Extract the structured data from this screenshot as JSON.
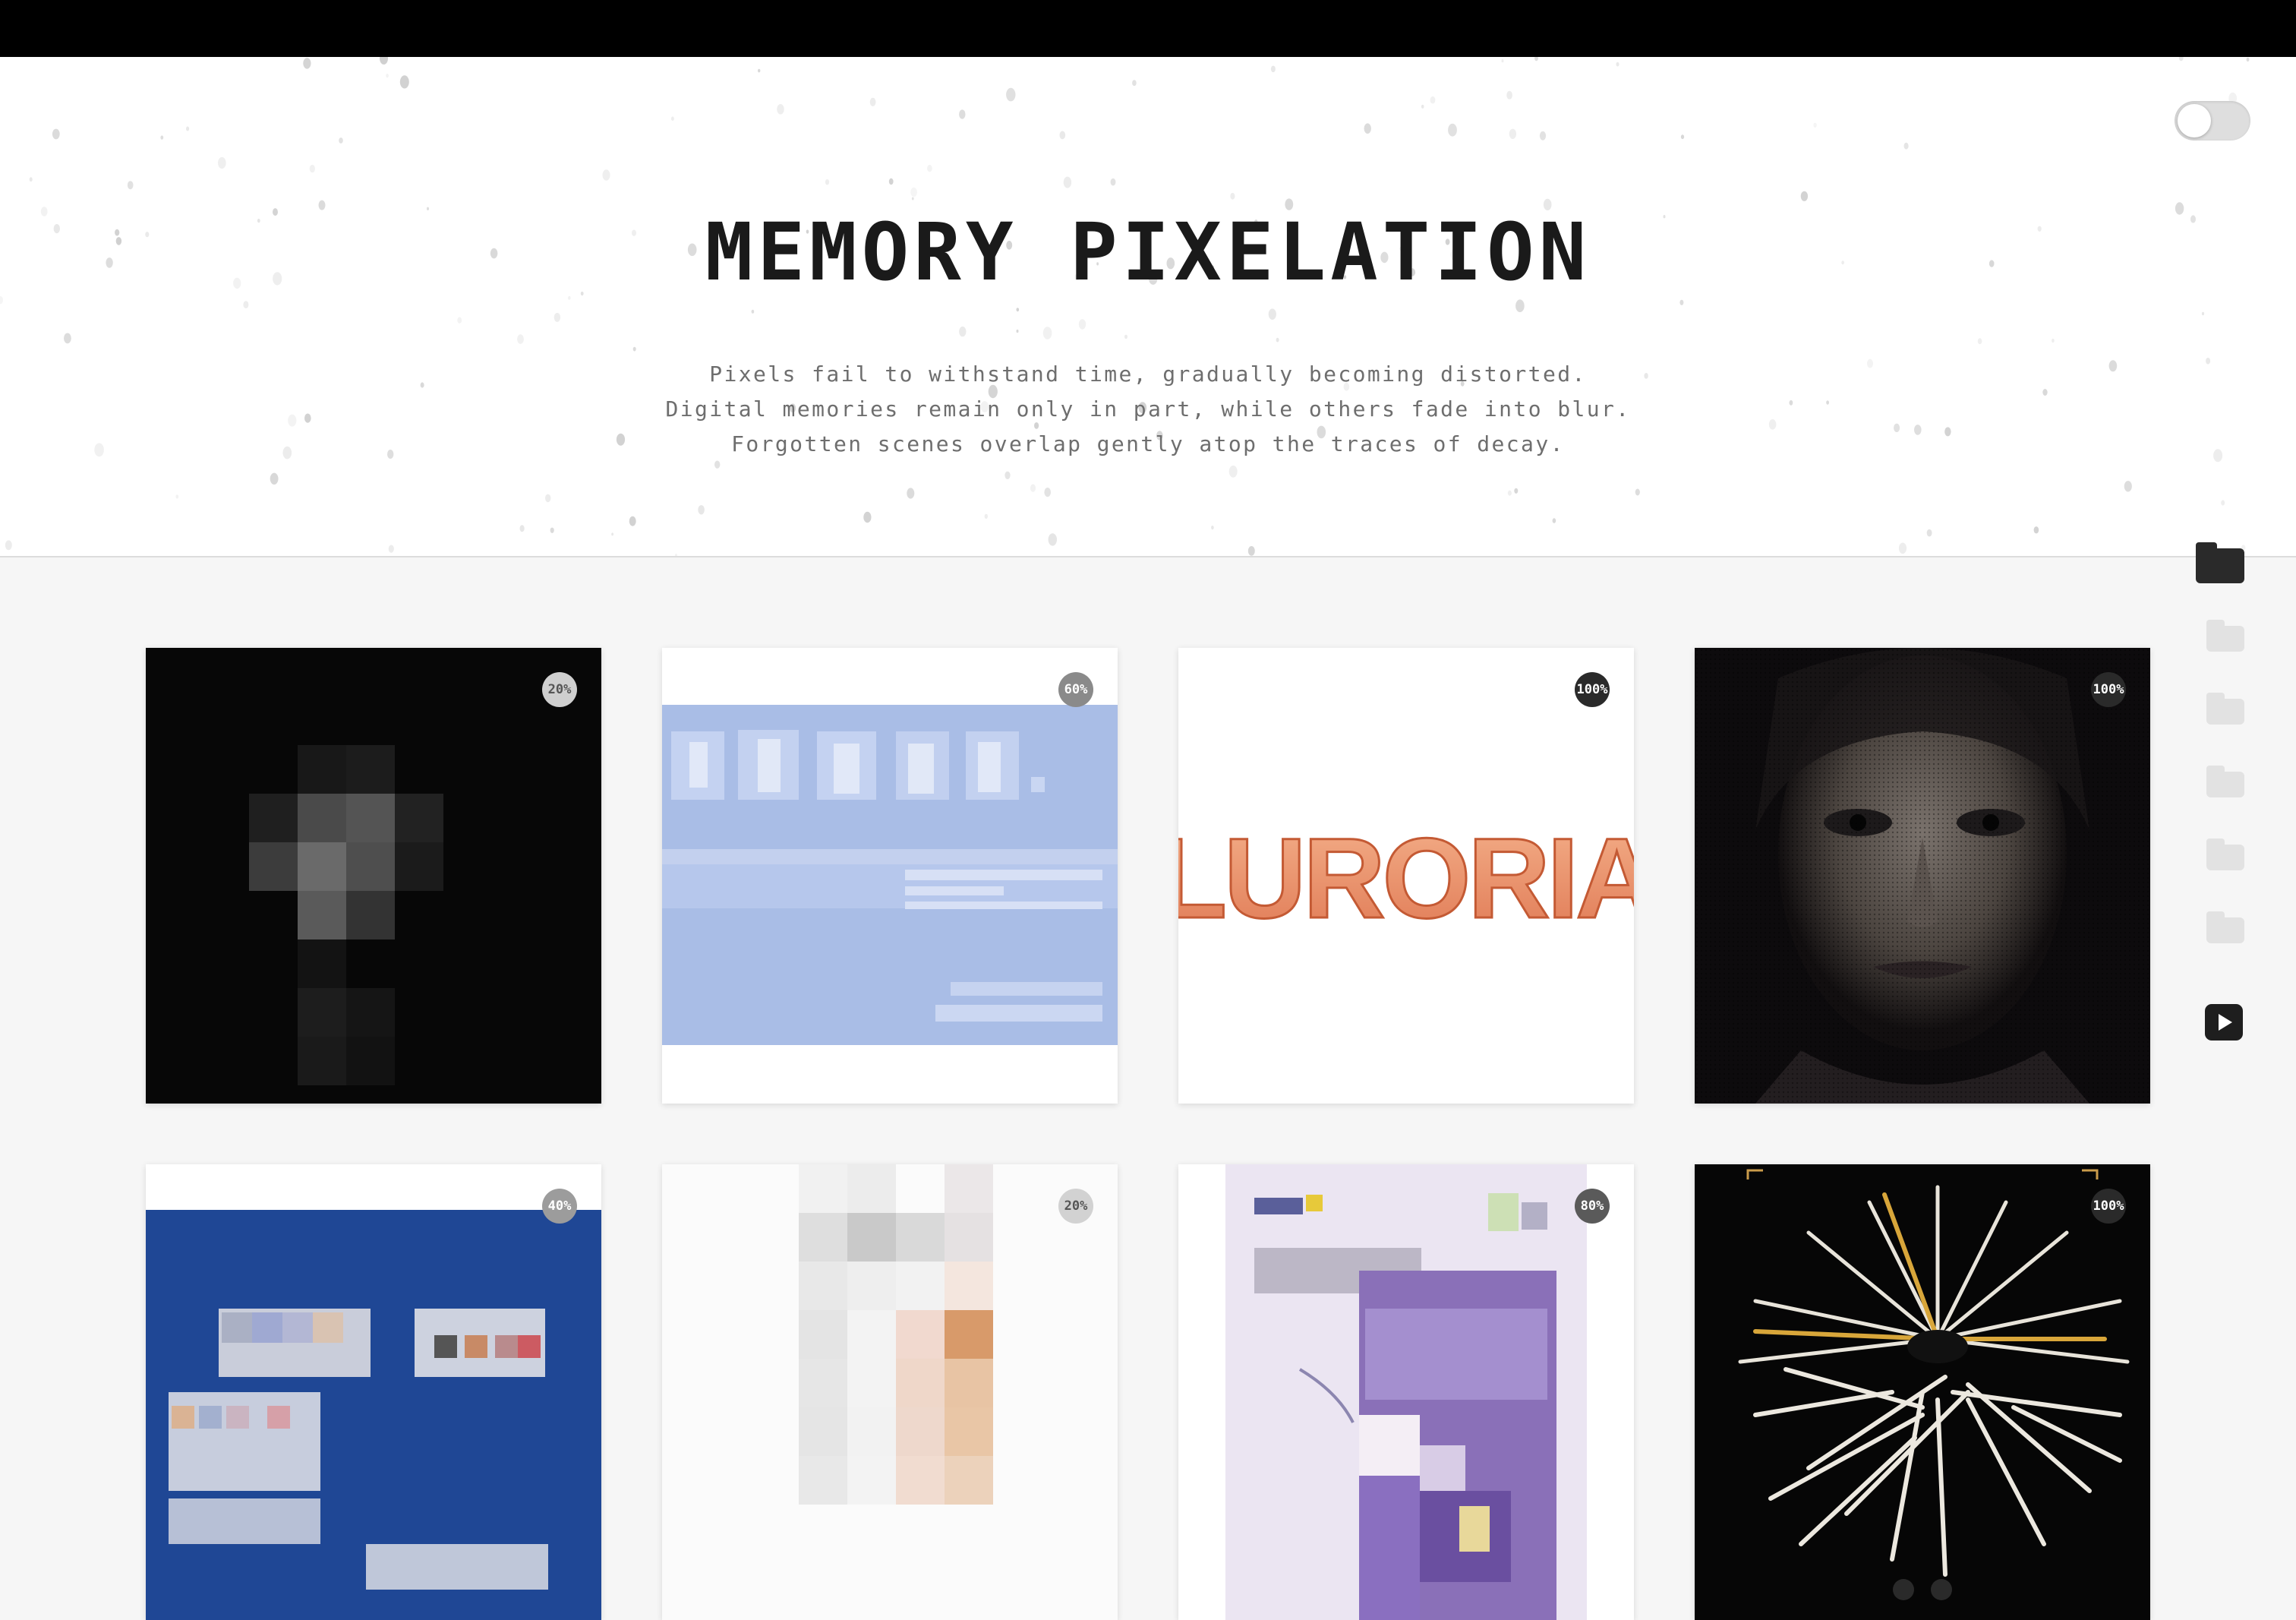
{
  "header": {
    "title": "MEMORY PIXELATION",
    "subtitle_lines": [
      "Pixels fail to withstand time, gradually becoming distorted.",
      "Digital memories remain only in part, while others fade into blur.",
      "Forgotten scenes overlap gently atop the traces of decay."
    ]
  },
  "theme_toggle": {
    "state": "off"
  },
  "sidebar": {
    "items": [
      {
        "icon": "folder-icon",
        "active": true
      },
      {
        "icon": "folder-icon",
        "active": false
      },
      {
        "icon": "folder-icon",
        "active": false
      },
      {
        "icon": "folder-icon",
        "active": false
      },
      {
        "icon": "folder-icon",
        "active": false
      },
      {
        "icon": "folder-icon",
        "active": false
      },
      {
        "icon": "play-icon",
        "active": false
      }
    ]
  },
  "gallery": [
    {
      "badge": "20%",
      "progress": 0.2,
      "badge_color": "#cfcfcf",
      "text_color": "#555555",
      "art": "dark-cross"
    },
    {
      "badge": "60%",
      "progress": 0.6,
      "badge_color": "#8a8a8a",
      "text_color": "#ffffff",
      "art": "blue-chinese-text"
    },
    {
      "badge": "100%",
      "progress": 1.0,
      "badge_color": "#2a2a2a",
      "text_color": "#ffffff",
      "art": "luroria-logo",
      "label": "LURORIA"
    },
    {
      "badge": "100%",
      "progress": 1.0,
      "badge_color": "#2a2a2a",
      "text_color": "#ffffff",
      "art": "face-portrait"
    },
    {
      "badge": "40%",
      "progress": 0.4,
      "badge_color": "#9c9c9c",
      "text_color": "#ffffff",
      "art": "blue-palette-grid"
    },
    {
      "badge": "20%",
      "progress": 0.2,
      "badge_color": "#d2d2d2",
      "text_color": "#555555",
      "art": "pale-blocks"
    },
    {
      "badge": "80%",
      "progress": 0.8,
      "badge_color": "#5a5a5a",
      "text_color": "#ffffff",
      "art": "purple-poster"
    },
    {
      "badge": "100%",
      "progress": 1.0,
      "badge_color": "#2a2a2a",
      "text_color": "#ffffff",
      "art": "starburst-sculpture"
    }
  ]
}
